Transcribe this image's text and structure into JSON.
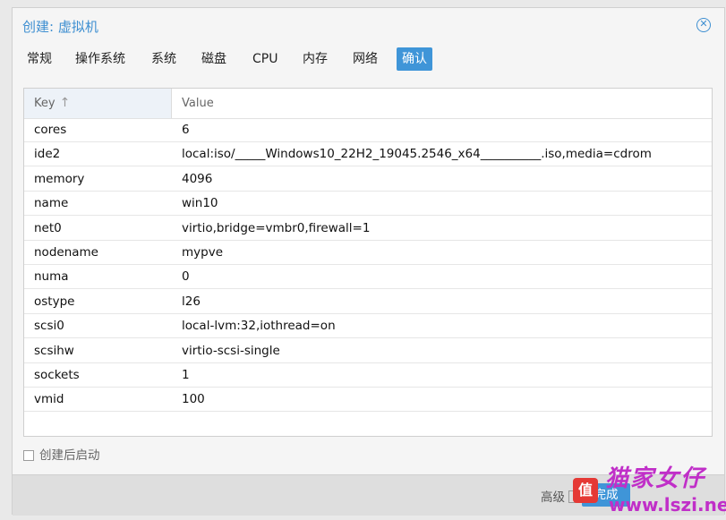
{
  "window": {
    "title": "创建: 虚拟机"
  },
  "tabs": [
    {
      "label": "常规"
    },
    {
      "label": "操作系统"
    },
    {
      "label": "系统"
    },
    {
      "label": "磁盘"
    },
    {
      "label": "CPU"
    },
    {
      "label": "内存"
    },
    {
      "label": "网络"
    },
    {
      "label": "确认",
      "active": true
    }
  ],
  "grid": {
    "columns": [
      "Key",
      "Value"
    ],
    "sort_indicator": "↑",
    "rows": [
      {
        "key": "cores",
        "value": "6"
      },
      {
        "key": "ide2",
        "value": "local:iso/_____Windows10_22H2_19045.2546_x64__________.iso,media=cdrom"
      },
      {
        "key": "memory",
        "value": "4096"
      },
      {
        "key": "name",
        "value": "win10"
      },
      {
        "key": "net0",
        "value": "virtio,bridge=vmbr0,firewall=1"
      },
      {
        "key": "nodename",
        "value": "mypve"
      },
      {
        "key": "numa",
        "value": "0"
      },
      {
        "key": "ostype",
        "value": "l26"
      },
      {
        "key": "scsi0",
        "value": "local-lvm:32,iothread=on"
      },
      {
        "key": "scsihw",
        "value": "virtio-scsi-single"
      },
      {
        "key": "sockets",
        "value": "1"
      },
      {
        "key": "vmid",
        "value": "100"
      }
    ]
  },
  "start_after_create": {
    "label": "创建后启动",
    "checked": false
  },
  "footer": {
    "advanced_label": "高级",
    "finish_label": "完成"
  },
  "watermark": {
    "badge": "值",
    "script": "猫家女仔",
    "url": "www.lszi.net"
  },
  "colors": {
    "accent": "#3f95d8",
    "title": "#3e8fd1"
  }
}
